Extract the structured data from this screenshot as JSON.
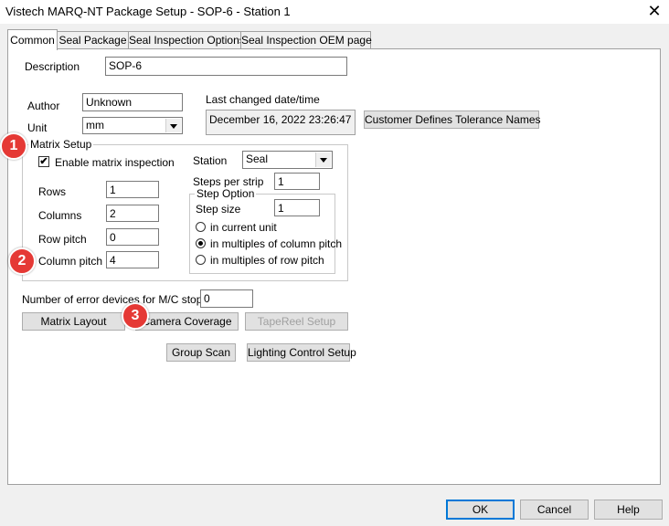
{
  "window": {
    "title": "Vistech MARQ-NT Package Setup - SOP-6 - Station 1",
    "close_glyph": "✕"
  },
  "tabs": [
    {
      "label": "Common"
    },
    {
      "label": "Seal Package"
    },
    {
      "label": "Seal Inspection Options"
    },
    {
      "label": "Seal Inspection OEM page"
    }
  ],
  "common": {
    "description_label": "Description",
    "description_value": "SOP-6",
    "author_label": "Author",
    "author_value": "Unknown",
    "unit_label": "Unit",
    "unit_value": "mm",
    "last_changed_label": "Last changed date/time",
    "last_changed_value": "December 16, 2022 23:26:47",
    "tolerance_button": "Customer Defines Tolerance Names",
    "matrix": {
      "group_label": "Matrix Setup",
      "enable_label": "Enable matrix inspection",
      "enable_checked_glyph": "✔",
      "rows_label": "Rows",
      "rows_value": "1",
      "columns_label": "Columns",
      "columns_value": "2",
      "row_pitch_label": "Row pitch",
      "row_pitch_value": "0",
      "column_pitch_label": "Column pitch",
      "column_pitch_value": "4",
      "station_label": "Station",
      "station_value": "Seal",
      "steps_per_strip_label": "Steps per strip",
      "steps_per_strip_value": "1",
      "step_option": {
        "group_label": "Step Option",
        "step_size_label": "Step size",
        "step_size_value": "1",
        "options": [
          {
            "label": "in current unit",
            "selected": false
          },
          {
            "label": "in multiples of column pitch",
            "selected": true
          },
          {
            "label": "in multiples of row pitch",
            "selected": false
          }
        ]
      }
    },
    "error_devices_label": "Number of error devices for M/C stop",
    "error_devices_value": "0",
    "buttons": {
      "matrix_layout": "Matrix Layout",
      "camera_coverage": "Camera Coverage",
      "tapereel_setup": "TapeReel Setup",
      "group_scan": "Group Scan",
      "lighting_control": "Lighting Control Setup"
    }
  },
  "annotations": [
    "1",
    "2",
    "3"
  ],
  "dialog_buttons": {
    "ok": "OK",
    "cancel": "Cancel",
    "help": "Help"
  },
  "colors": {
    "marker": "#e53935",
    "focus_border": "#0078d7"
  }
}
